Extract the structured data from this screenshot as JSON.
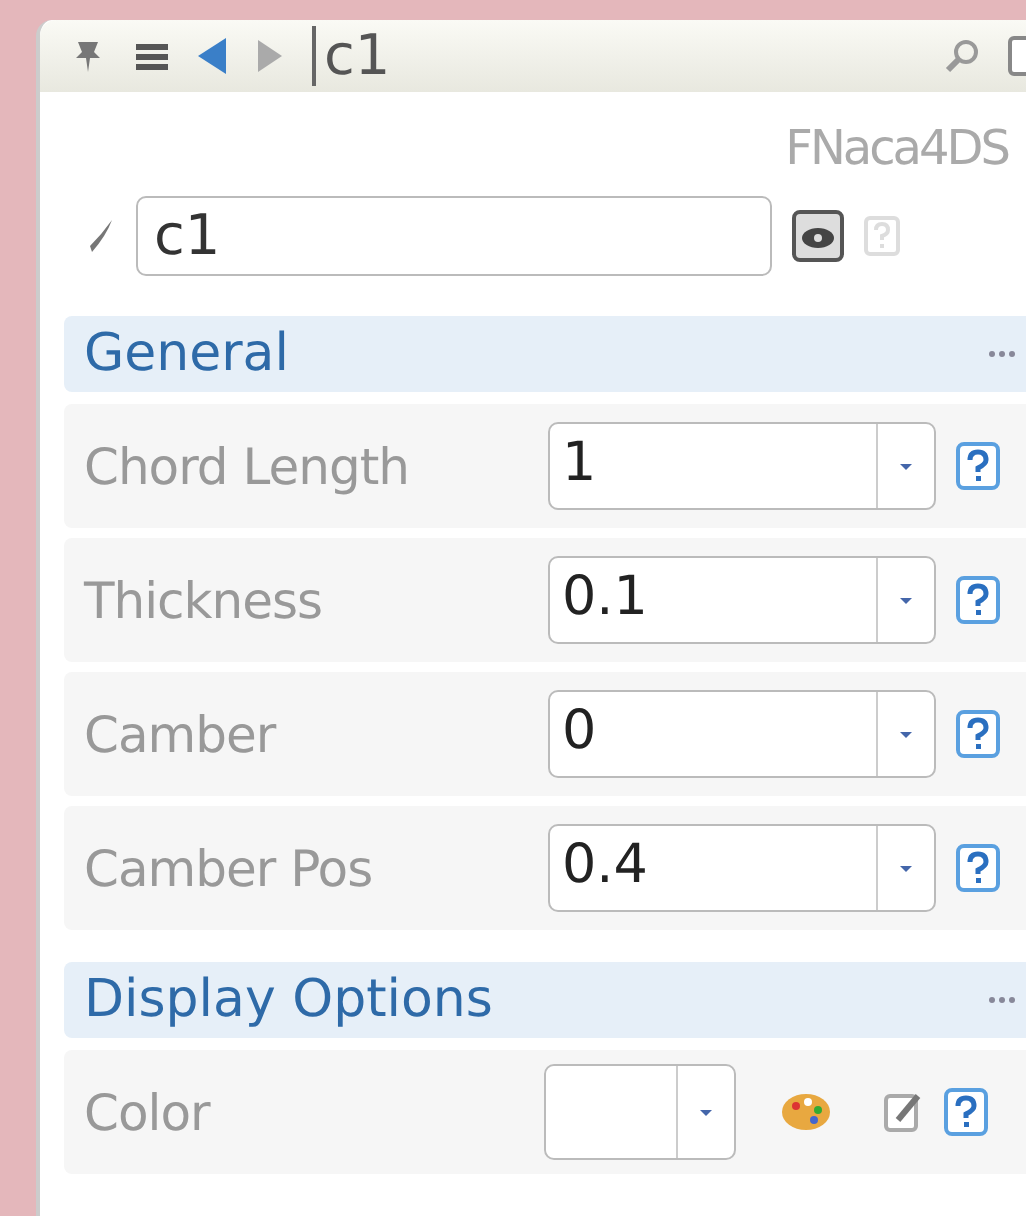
{
  "toolbar": {
    "title": "c1"
  },
  "object_type": "FNaca4DS",
  "name_field": {
    "value": "c1"
  },
  "sections": [
    {
      "title": "General",
      "rows": [
        {
          "kind": "combo",
          "label": "Chord Length",
          "value": "1"
        },
        {
          "kind": "combo",
          "label": "Thickness",
          "value": "0.1"
        },
        {
          "kind": "combo",
          "label": "Camber",
          "value": "0"
        },
        {
          "kind": "combo",
          "label": "Camber Pos",
          "value": "0.4"
        }
      ]
    },
    {
      "title": "Display Options",
      "rows": [
        {
          "kind": "color",
          "label": "Color",
          "color": "#ffffff"
        }
      ]
    }
  ]
}
